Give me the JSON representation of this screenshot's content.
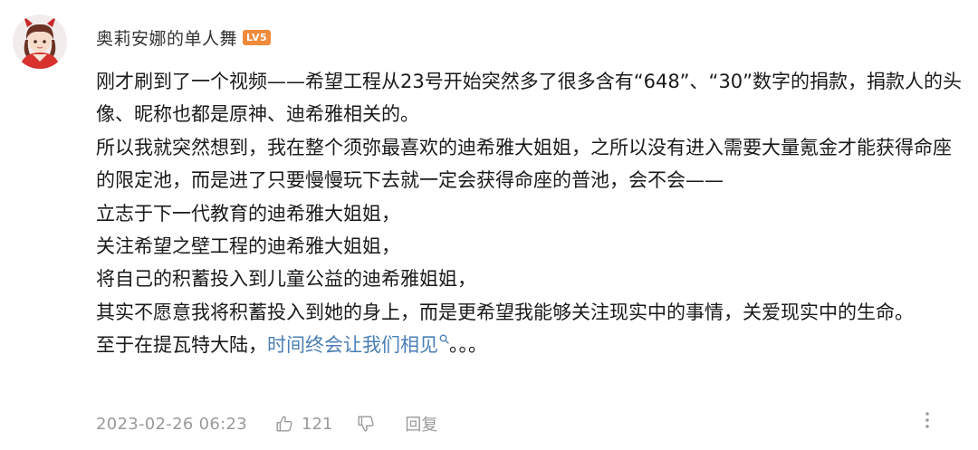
{
  "user": {
    "avatar_icon": "anime-girl-avatar",
    "name": "奥莉安娜的单人舞",
    "level": "LV5",
    "level_color": "#f08a3c"
  },
  "comment": {
    "paragraphs": [
      "刚才刷到了一个视频——希望工程从23号开始突然多了很多含有“648”、“30”数字的捐款，捐款人的头像、昵称也都是原神、迪希雅相关的。",
      "所以我就突然想到，我在整个须弥最喜欢的迪希雅大姐姐，之所以没有进入需要大量氪金才能获得命座的限定池，而是进了只要慢慢玩下去就一定会获得命座的普池，会不会——",
      "立志于下一代教育的迪希雅大姐姐，",
      "关注希望之壁工程的迪希雅大姐姐，",
      "将自己的积蓄投入到儿童公益的迪希雅姐姐，",
      "其实不愿意我将积蓄投入到她的身上，而是更希望我能够关注现实中的事情，关爱现实中的生命。"
    ],
    "last_line": {
      "prefix": "至于在提瓦特大陆，",
      "topic_link": "时间终会让我们相见",
      "topic_icon": "search-icon",
      "suffix": "。。。"
    },
    "link_color": "#4a7fb5"
  },
  "footer": {
    "timestamp": "2023-02-26 06:23",
    "like_icon": "thumbs-up-icon",
    "like_count": "121",
    "dislike_icon": "thumbs-down-icon",
    "reply_label": "回复",
    "more_icon": "more-vertical-icon"
  }
}
